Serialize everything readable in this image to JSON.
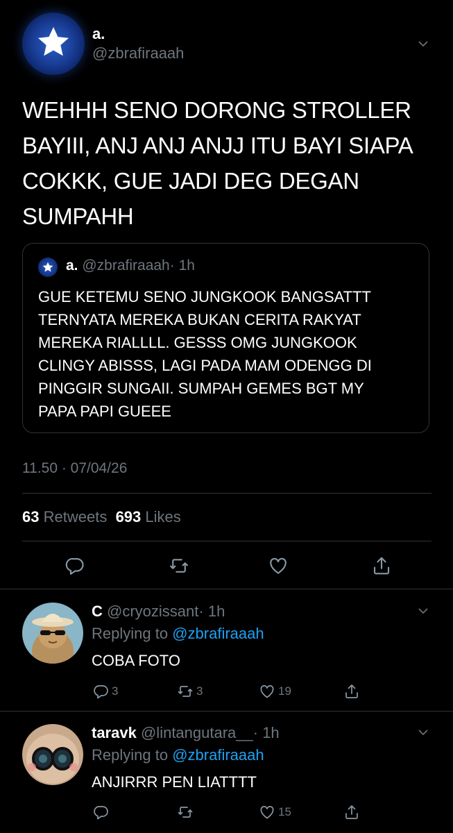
{
  "main_tweet": {
    "display_name": "a.",
    "handle": "@zbrafiraaah",
    "text_lines": [
      "WEHHH SENO DORONG STROLLER",
      "BAYIII, ANJ ANJ ANJJ ITU BAYI SIAPA",
      "COKKK, GUE JADI DEG DEGAN",
      "SUMPAHH"
    ],
    "timestamp": "11.50 · 07/04/26",
    "retweet_count": "63",
    "retweet_label": "Retweets",
    "like_count": "693",
    "like_label": "Likes"
  },
  "quoted_tweet": {
    "display_name": "a.",
    "handle": "@zbrafiraaah",
    "time": "· 1h",
    "text_lines": [
      "GUE KETEMU SENO JUNGKOOK BANGSATTT",
      "TERNYATA MEREKA BUKAN CERITA RAKYAT",
      "MEREKA RIALLLL. GESSS OMG JUNGKOOK",
      "CLINGY ABISSS, LAGI PADA MAM ODENGG DI",
      "PINGGIR SUNGAII. SUMPAH GEMES BGT MY",
      "PAPA PAPI GUEEE"
    ]
  },
  "replies": [
    {
      "display_name": "C",
      "handle": "@cryozissant",
      "time": "· 1h",
      "replying_prefix": "Replying to",
      "replying_handle": "@zbrafiraaah",
      "text": "COBA FOTO",
      "reply_count": "3",
      "retweet_count": "3",
      "like_count": "19"
    },
    {
      "display_name": "taravk",
      "handle": "@lintangutara__",
      "time": "· 1h",
      "replying_prefix": "Replying to",
      "replying_handle": "@zbrafiraaah",
      "text": "ANJIRRR PEN LIATTTT",
      "reply_count": "",
      "retweet_count": "",
      "like_count": "15"
    }
  ],
  "icons": {
    "chevron": "chevron-down-icon",
    "reply": "reply-icon",
    "retweet": "retweet-icon",
    "like": "heart-icon",
    "share": "share-icon"
  },
  "colors": {
    "background": "#000000",
    "text": "#ffffff",
    "muted": "#6e767d",
    "link": "#1da1f2",
    "divider": "#2f3336"
  }
}
